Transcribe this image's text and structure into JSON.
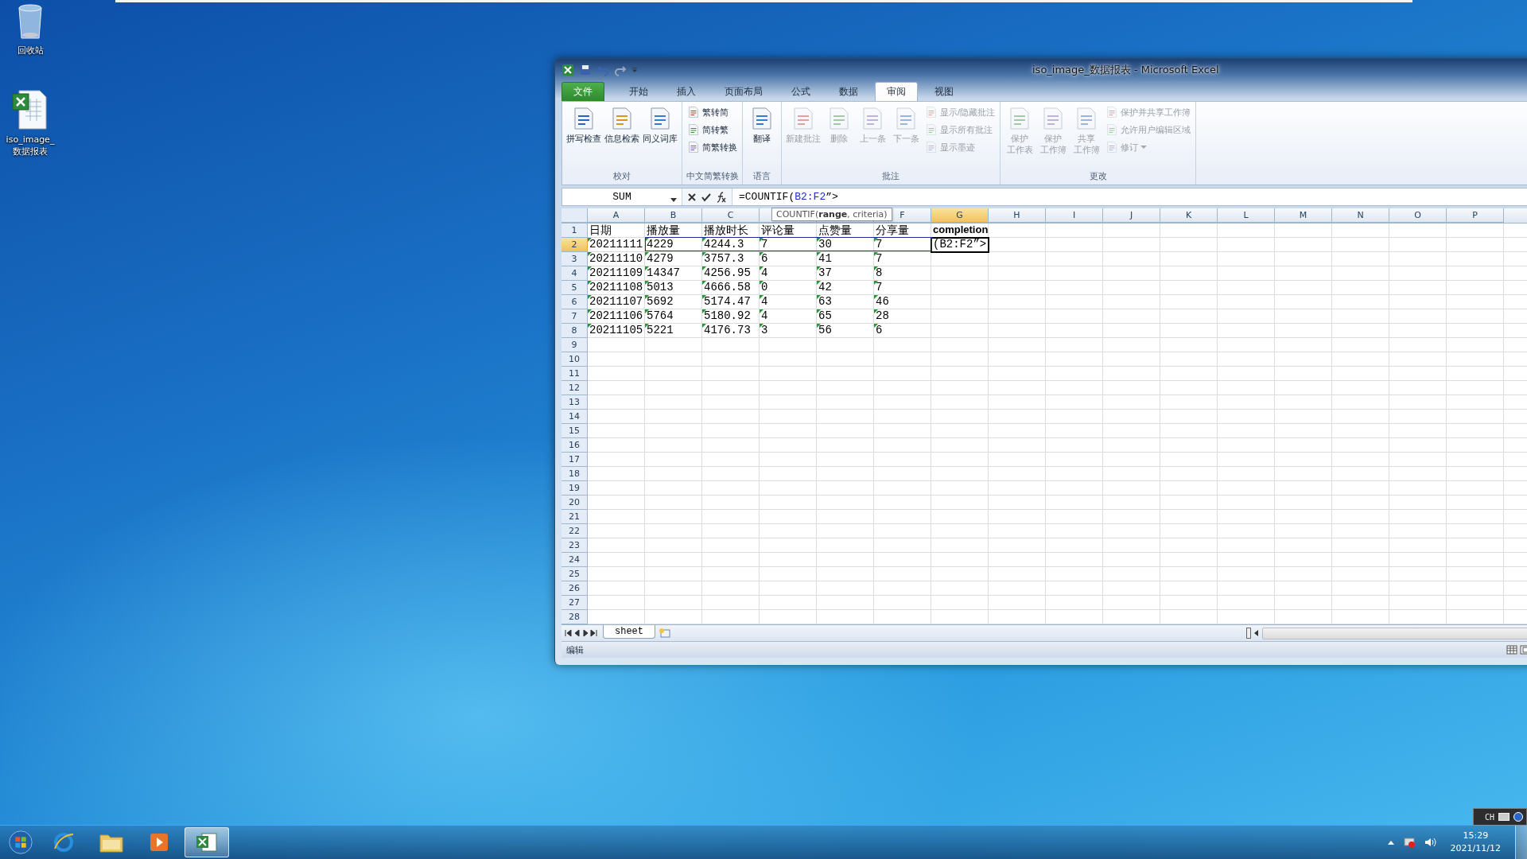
{
  "desktop_icons": [
    {
      "kind": "trash",
      "lines": [
        "回收站"
      ]
    },
    {
      "kind": "sheet_file",
      "lines": [
        "iso_image_",
        "数据报表"
      ]
    }
  ],
  "window": {
    "title": "iso_image_数据报表  -  Microsoft Excel"
  },
  "tabs": [
    {
      "label": "文件",
      "kind": "file",
      "selected": false
    },
    {
      "label": "开始",
      "kind": "tab",
      "selected": false
    },
    {
      "label": "插入",
      "kind": "tab",
      "selected": false
    },
    {
      "label": "页面布局",
      "kind": "tab",
      "selected": false
    },
    {
      "label": "公式",
      "kind": "tab",
      "selected": false
    },
    {
      "label": "数据",
      "kind": "tab",
      "selected": false
    },
    {
      "label": "审阅",
      "kind": "tab",
      "selected": true
    },
    {
      "label": "视图",
      "kind": "tab",
      "selected": false
    }
  ],
  "ribbon_groups": [
    {
      "label": "校对",
      "items": [
        {
          "kind": "large",
          "lines": [
            "拼写检查"
          ],
          "disabled": false
        },
        {
          "kind": "large",
          "lines": [
            "信息检索"
          ],
          "disabled": false
        },
        {
          "kind": "large",
          "lines": [
            "同义词库"
          ],
          "disabled": false
        }
      ]
    },
    {
      "label": "中文简繁转换",
      "items": [
        {
          "kind": "small",
          "lines": [
            "繁转简"
          ],
          "disabled": false
        },
        {
          "kind": "small",
          "lines": [
            "简转繁"
          ],
          "disabled": false
        },
        {
          "kind": "small",
          "lines": [
            "简繁转换"
          ],
          "disabled": false
        }
      ]
    },
    {
      "label": "语言",
      "items": [
        {
          "kind": "large",
          "lines": [
            "翻译"
          ],
          "disabled": false
        }
      ]
    },
    {
      "label": "批注",
      "items": [
        {
          "kind": "large",
          "lines": [
            "新建批注"
          ],
          "disabled": true
        },
        {
          "kind": "large",
          "lines": [
            "删除"
          ],
          "disabled": true
        },
        {
          "kind": "large",
          "lines": [
            "上一条"
          ],
          "disabled": true
        },
        {
          "kind": "large",
          "lines": [
            "下一条"
          ],
          "disabled": true
        },
        {
          "kind": "small",
          "lines": [
            "显示/隐藏批注"
          ],
          "disabled": true
        },
        {
          "kind": "small",
          "lines": [
            "显示所有批注"
          ],
          "disabled": true
        },
        {
          "kind": "small",
          "lines": [
            "显示墨迹"
          ],
          "disabled": true
        }
      ]
    },
    {
      "label": "更改",
      "items": [
        {
          "kind": "large",
          "lines": [
            "保护",
            "工作表"
          ],
          "disabled": true
        },
        {
          "kind": "large",
          "lines": [
            "保护",
            "工作簿"
          ],
          "disabled": true
        },
        {
          "kind": "large",
          "lines": [
            "共享",
            "工作簿"
          ],
          "disabled": true
        },
        {
          "kind": "small",
          "lines": [
            "保护并共享工作簿"
          ],
          "disabled": true
        },
        {
          "kind": "small",
          "lines": [
            "允许用户编辑区域"
          ],
          "disabled": true
        },
        {
          "kind": "small",
          "lines": [
            "修订"
          ],
          "disabled": true,
          "dropdown": true
        }
      ]
    }
  ],
  "formula_bar": {
    "name_box": "SUM",
    "formula": {
      "start": "=COUNTIF(",
      "reference": "B2:F2",
      "end": "”>"
    }
  },
  "tooltip": "COUNTIF(**range**, criteria)",
  "sheet": {
    "columns": [
      {
        "label": "A",
        "selected": false
      },
      {
        "label": "B",
        "selected": false
      },
      {
        "label": "C",
        "selected": false
      },
      {
        "selected": false
      },
      {
        "selected": false
      },
      {
        "label": "F",
        "selected": false
      },
      {
        "label": "G",
        "selected": true
      },
      {
        "label": "H",
        "selected": false
      },
      {
        "label": "I",
        "selected": false
      },
      {
        "label": "J",
        "selected": false
      },
      {
        "label": "K",
        "selected": false
      },
      {
        "label": "L",
        "selected": false
      },
      {
        "label": "M",
        "selected": false
      },
      {
        "label": "N",
        "selected": false
      },
      {
        "label": "O",
        "selected": false
      },
      {
        "label": "P",
        "selected": false
      }
    ],
    "rows": [
      {
        "number": "1",
        "selected": false,
        "flagged": false,
        "cells": [
          {
            "text": "日期",
            "bold": false
          },
          {
            "text": "播放量",
            "bold": false
          },
          {
            "text": "播放时长",
            "bold": false
          },
          {
            "text": "评论量",
            "bold": false
          },
          {
            "text": "点赞量",
            "bold": false
          },
          {
            "text": "分享量",
            "bold": false
          },
          {
            "text": "completion",
            "bold": true
          }
        ]
      },
      {
        "number": "2",
        "selected": true,
        "flagged": true,
        "cells": [
          "20211111",
          "4229",
          "4244.3",
          "7",
          "30",
          "7"
        ],
        "editing": "(B2:F2”>"
      },
      {
        "number": "3",
        "selected": false,
        "flagged": true,
        "cells": [
          "20211110",
          "4279",
          "3757.3",
          "6",
          "41",
          "7"
        ]
      },
      {
        "number": "4",
        "selected": false,
        "flagged": true,
        "cells": [
          "20211109",
          "14347",
          "4256.95",
          "4",
          "37",
          "8"
        ]
      },
      {
        "number": "5",
        "selected": false,
        "flagged": true,
        "cells": [
          "20211108",
          "5013",
          "4666.58",
          "0",
          "42",
          "7"
        ]
      },
      {
        "number": "6",
        "selected": false,
        "flagged": true,
        "cells": [
          "20211107",
          "5692",
          "5174.47",
          "4",
          "63",
          "46"
        ]
      },
      {
        "number": "7",
        "selected": false,
        "flagged": true,
        "cells": [
          "20211106",
          "5764",
          "5180.92",
          "4",
          "65",
          "28"
        ]
      },
      {
        "number": "8",
        "selected": false,
        "flagged": true,
        "cells": [
          "20211105",
          "5221",
          "4176.73",
          "3",
          "56",
          "6"
        ]
      },
      {
        "number": "9"
      },
      {
        "number": "10"
      },
      {
        "number": "11"
      },
      {
        "number": "12"
      },
      {
        "number": "13"
      },
      {
        "number": "14"
      },
      {
        "number": "15"
      },
      {
        "number": "16"
      },
      {
        "number": "17"
      },
      {
        "number": "18"
      },
      {
        "number": "19"
      },
      {
        "number": "20"
      },
      {
        "number": "21"
      },
      {
        "number": "22"
      },
      {
        "number": "23"
      },
      {
        "number": "24"
      },
      {
        "number": "25"
      },
      {
        "number": "26"
      },
      {
        "number": "27"
      },
      {
        "number": "28"
      }
    ]
  },
  "sheet_tabs": [
    {
      "label": "sheet",
      "selected": true
    }
  ],
  "status_bar": {
    "mode": "编辑"
  },
  "taskbar": {
    "apps": [
      {
        "kind": "browser",
        "active": false
      },
      {
        "kind": "folder",
        "active": false
      },
      {
        "kind": "media",
        "active": false
      },
      {
        "kind": "spreadsheet",
        "active": true
      }
    ],
    "language": "CH",
    "time": "15:29",
    "date": "2021/11/12"
  }
}
